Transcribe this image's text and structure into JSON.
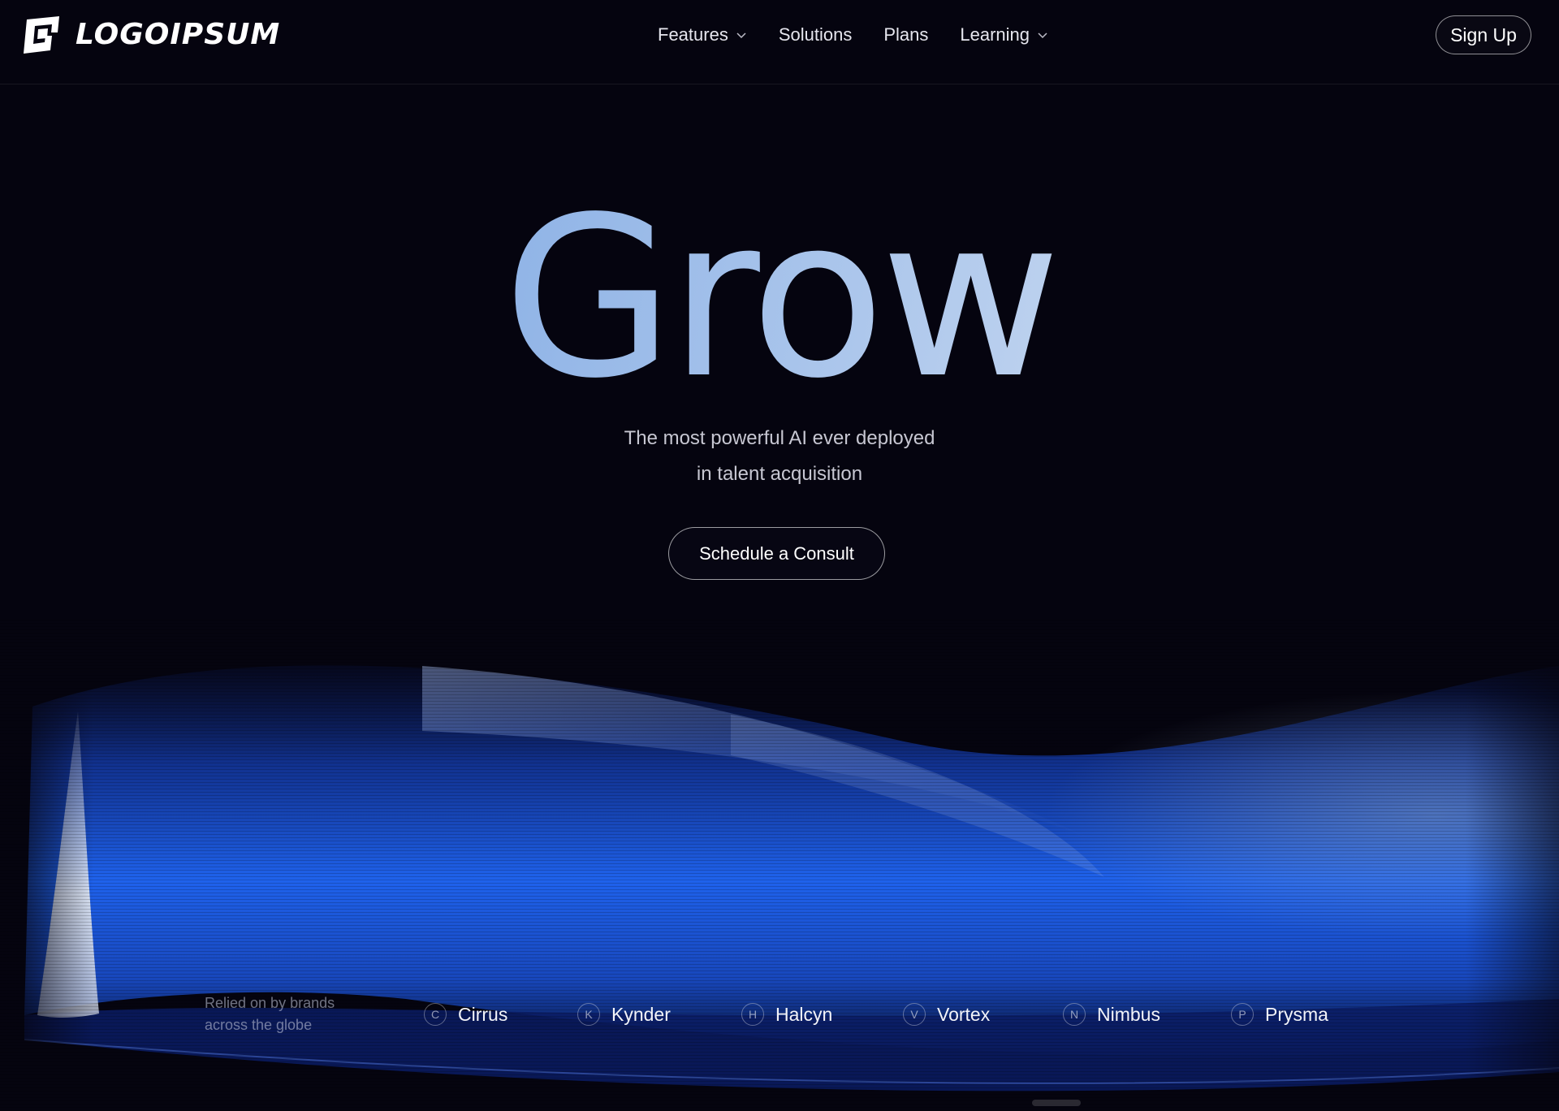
{
  "header": {
    "logo_text": "LOGOIPSUM",
    "nav": [
      {
        "label": "Features",
        "has_dropdown": true,
        "icon": "chevron-down-icon"
      },
      {
        "label": "Solutions",
        "has_dropdown": false
      },
      {
        "label": "Plans",
        "has_dropdown": false
      },
      {
        "label": "Learning",
        "has_dropdown": true,
        "icon": "chevron-down-icon"
      }
    ],
    "signup_label": "Sign Up"
  },
  "hero": {
    "title": "Grow",
    "subtitle_line1": "The most powerful AI ever deployed",
    "subtitle_line2": "in talent acquisition",
    "cta_label": "Schedule a Consult"
  },
  "brands": {
    "caption_line1": "Relied on by brands",
    "caption_line2": "across the globe",
    "items": [
      {
        "initial": "C",
        "name": "Cirrus"
      },
      {
        "initial": "K",
        "name": "Kynder"
      },
      {
        "initial": "H",
        "name": "Halcyn"
      },
      {
        "initial": "V",
        "name": "Vortex"
      },
      {
        "initial": "N",
        "name": "Nimbus"
      },
      {
        "initial": "P",
        "name": "Prysma"
      }
    ]
  },
  "colors": {
    "background": "#05040f",
    "accent_blue": "#1f5fe0",
    "title_gradient_start": "#6b98dc",
    "title_gradient_end": "#dde7f4"
  }
}
